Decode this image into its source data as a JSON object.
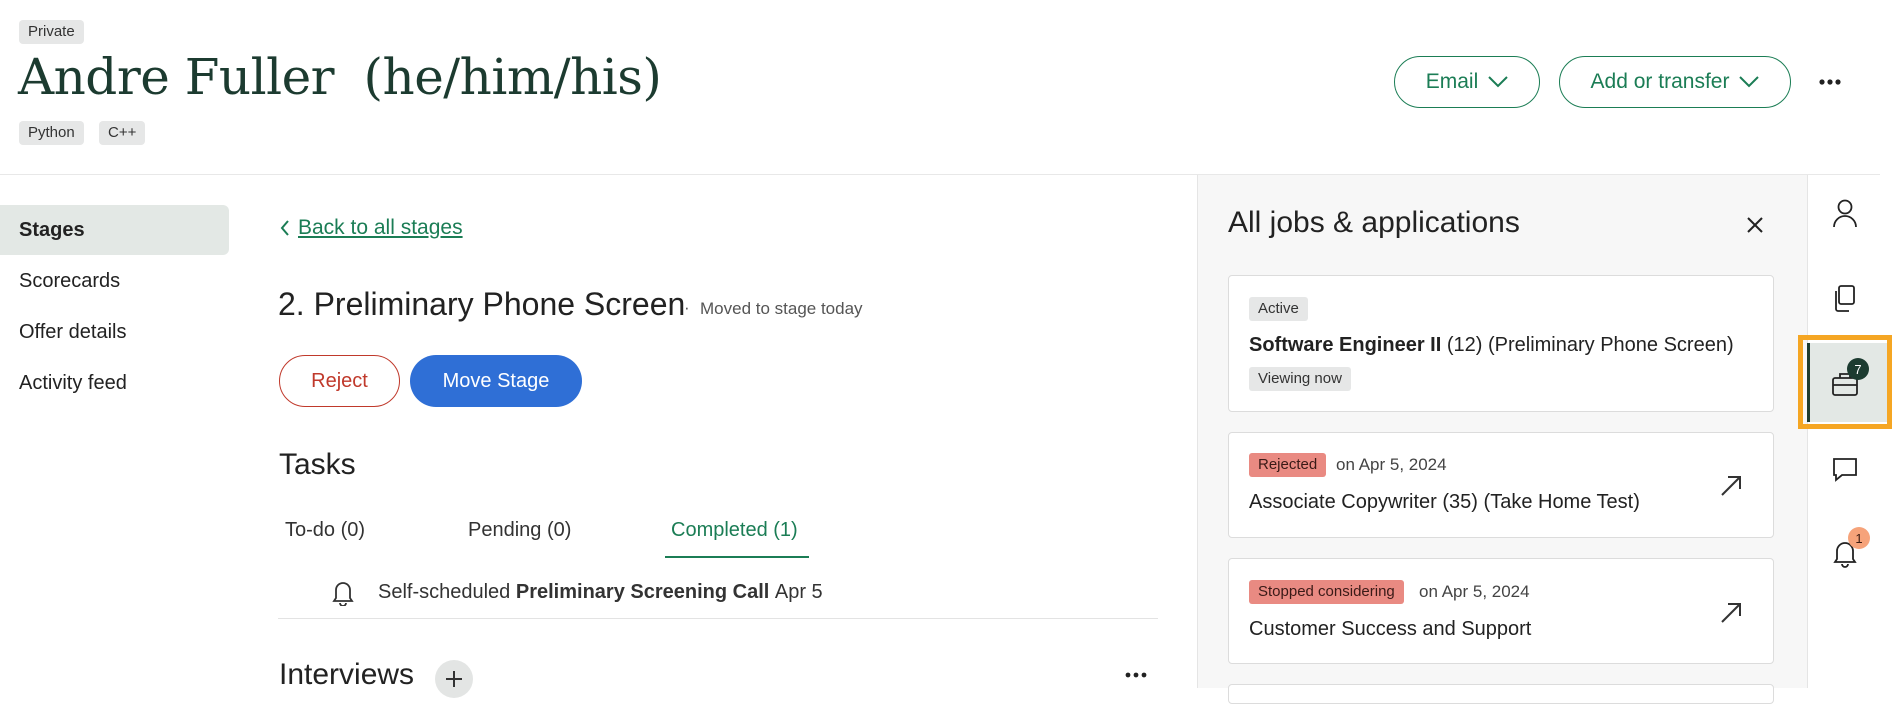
{
  "header": {
    "privacy_tag": "Private",
    "name": "Andre Fuller",
    "pronouns": "(he/him/his)",
    "tags": [
      "Python",
      "C++"
    ],
    "email_label": "Email",
    "add_transfer_label": "Add or transfer",
    "more_icon": "more-horizontal-icon"
  },
  "sidebar": {
    "items": [
      {
        "label": "Stages",
        "active": true
      },
      {
        "label": "Scorecards",
        "active": false
      },
      {
        "label": "Offer details",
        "active": false
      },
      {
        "label": "Activity feed",
        "active": false
      }
    ]
  },
  "main": {
    "back_link": "Back to all stages",
    "stage_title": "2. Preliminary Phone Screen",
    "stage_separator": "·",
    "stage_subtitle": "Moved to stage today",
    "reject_label": "Reject",
    "move_label": "Move Stage",
    "tasks_heading": "Tasks",
    "task_tabs": [
      {
        "label": "To-do (0)",
        "active": false
      },
      {
        "label": "Pending (0)",
        "active": false
      },
      {
        "label": "Completed (1)",
        "active": true
      }
    ],
    "task_item": {
      "prefix": "Self-scheduled",
      "bold": "Preliminary Screening Call",
      "date": "Apr 5"
    },
    "interviews_heading": "Interviews"
  },
  "panel": {
    "title": "All jobs & applications",
    "cards": [
      {
        "status": "Active",
        "job": "Software Engineer II",
        "count": "(12)",
        "stage": "(Preliminary Phone Screen)",
        "viewing": "Viewing now"
      },
      {
        "status": "Rejected",
        "date": "on Apr 5, 2024",
        "job": "Associate Copywriter (35)",
        "stage": "(Take Home Test)"
      },
      {
        "status": "Stopped considering",
        "date": "on Apr 5, 2024",
        "job": "Customer Success and Support"
      }
    ]
  },
  "rail": {
    "jobs_count": "7",
    "notifications_count": "1",
    "highlight_color": "#f5a623"
  },
  "colors": {
    "brand_green": "#1b7d55",
    "primary_blue": "#2f6fd6",
    "danger_red": "#c0392b",
    "badge_red": "#e98a82"
  }
}
